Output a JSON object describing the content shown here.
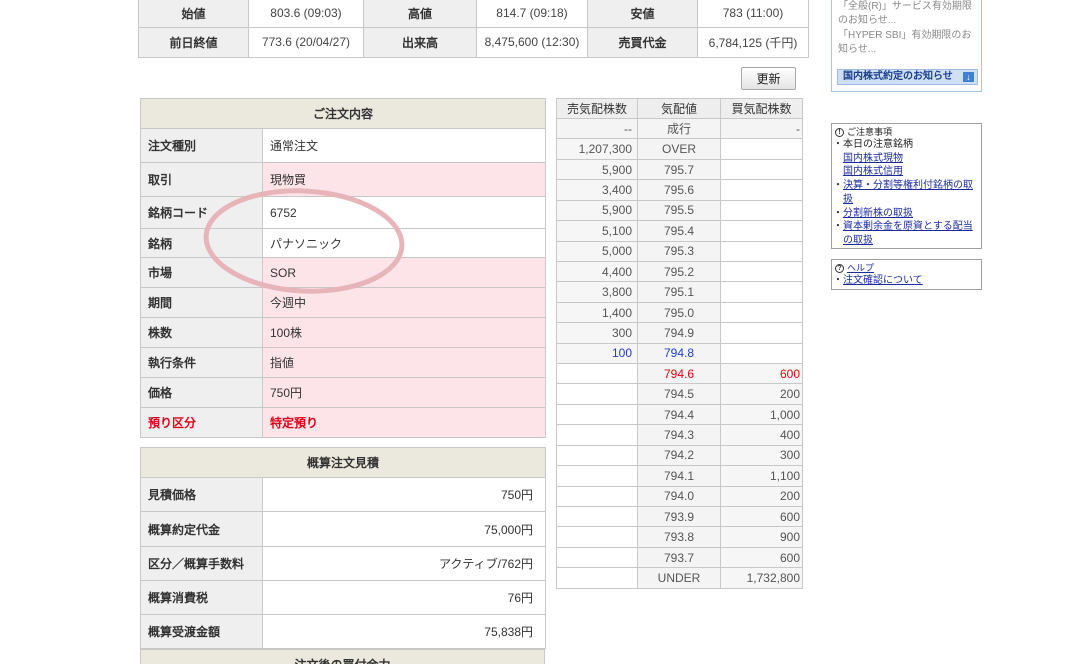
{
  "quote": {
    "rows": [
      [
        {
          "label": "始値",
          "value": "803.6 (09:03)"
        },
        {
          "label": "高値",
          "value": "814.7 (09:18)"
        },
        {
          "label": "安値",
          "value": "783 (11:00)"
        }
      ],
      [
        {
          "label": "前日終値",
          "value": "773.6 (20/04/27)"
        },
        {
          "label": "出来高",
          "value": "8,475,600 (12:30)"
        },
        {
          "label": "売買代金",
          "value": "6,784,125 (千円)"
        }
      ]
    ]
  },
  "toolbar": {
    "refresh_label": "更新"
  },
  "order": {
    "title": "ご注文内容",
    "rows": [
      {
        "label": "注文種別",
        "value": "通常注文"
      },
      {
        "label": "取引",
        "value": "現物買"
      },
      {
        "label": "銘柄コード",
        "value": "6752"
      },
      {
        "label": "銘柄",
        "value": "パナソニック"
      },
      {
        "label": "市場",
        "value": "SOR"
      },
      {
        "label": "期間",
        "value": "今週中"
      },
      {
        "label": "株数",
        "value": "100株"
      },
      {
        "label": "執行条件",
        "value": "指値"
      },
      {
        "label": "価格",
        "value": "750円"
      },
      {
        "label": "預り区分",
        "value": "特定預り"
      }
    ]
  },
  "estimate": {
    "title": "概算注文見積",
    "rows": [
      {
        "label": "見積価格",
        "value": "750円"
      },
      {
        "label": "概算約定代金",
        "value": "75,000円"
      },
      {
        "label": "区分／概算手数料",
        "value": "アクティブ/762円"
      },
      {
        "label": "概算消費税",
        "value": "76円"
      },
      {
        "label": "概算受渡金額",
        "value": "75,838円"
      }
    ]
  },
  "buying_power": {
    "title": "注文後の買付余力"
  },
  "board": {
    "headers": {
      "sell": "売気配株数",
      "price": "気配値",
      "buy": "買気配株数"
    },
    "rows": [
      {
        "sell": "--",
        "price": "成行",
        "buy": "-"
      },
      {
        "sell": "1,207,300",
        "price": "OVER",
        "buy": ""
      },
      {
        "sell": "5,900",
        "price": "795.7",
        "buy": ""
      },
      {
        "sell": "3,400",
        "price": "795.6",
        "buy": ""
      },
      {
        "sell": "5,900",
        "price": "795.5",
        "buy": ""
      },
      {
        "sell": "5,100",
        "price": "795.4",
        "buy": ""
      },
      {
        "sell": "5,000",
        "price": "795.3",
        "buy": ""
      },
      {
        "sell": "4,400",
        "price": "795.2",
        "buy": ""
      },
      {
        "sell": "3,800",
        "price": "795.1",
        "buy": ""
      },
      {
        "sell": "1,400",
        "price": "795.0",
        "buy": ""
      },
      {
        "sell": "300",
        "price": "794.9",
        "buy": ""
      },
      {
        "sell": "100",
        "price": "794.8",
        "buy": ""
      },
      {
        "sell": "",
        "price": "794.6",
        "buy": "600"
      },
      {
        "sell": "",
        "price": "794.5",
        "buy": "200"
      },
      {
        "sell": "",
        "price": "794.4",
        "buy": "1,000"
      },
      {
        "sell": "",
        "price": "794.3",
        "buy": "400"
      },
      {
        "sell": "",
        "price": "794.2",
        "buy": "300"
      },
      {
        "sell": "",
        "price": "794.1",
        "buy": "1,100"
      },
      {
        "sell": "",
        "price": "794.0",
        "buy": "200"
      },
      {
        "sell": "",
        "price": "793.9",
        "buy": "600"
      },
      {
        "sell": "",
        "price": "793.8",
        "buy": "900"
      },
      {
        "sell": "",
        "price": "793.7",
        "buy": "600"
      },
      {
        "sell": "",
        "price": "UNDER",
        "buy": "1,732,800"
      }
    ]
  },
  "notices": {
    "items": [
      "「全般(R)」サービス有効期限のお知らせ...",
      "「HYPER SBI」有効期限のお知らせ..."
    ],
    "banner": "国内株式約定のお知らせ"
  },
  "cautions": {
    "title": "ご注意事項",
    "heading": "本日の注意銘柄",
    "heading_links": [
      "国内株式現物",
      "国内株式信用"
    ],
    "links": [
      "決算・分割等権利付銘柄の取扱",
      "分割新株の取扱",
      "資本剰余金を原資とする配当の取扱"
    ]
  },
  "help": {
    "title": "ヘルプ",
    "links": [
      "注文確認について"
    ]
  },
  "icons": {
    "caution": "caution-icon",
    "help": "help-icon",
    "banner": "arrow-down-icon"
  },
  "colors": {
    "border": "#c8c8c8",
    "label_bg": "#efefef",
    "header_bg": "#ebe8de",
    "input_row_bg": "#fde4e9",
    "alert_text": "#e0001b",
    "best_ask": "#1f3fcf",
    "best_bid": "#e60012",
    "link": "#1d2c9c",
    "annotation": "#e7b5b9",
    "banner_bg": "#cfe0f4",
    "notice_border": "#a8c6e8"
  }
}
